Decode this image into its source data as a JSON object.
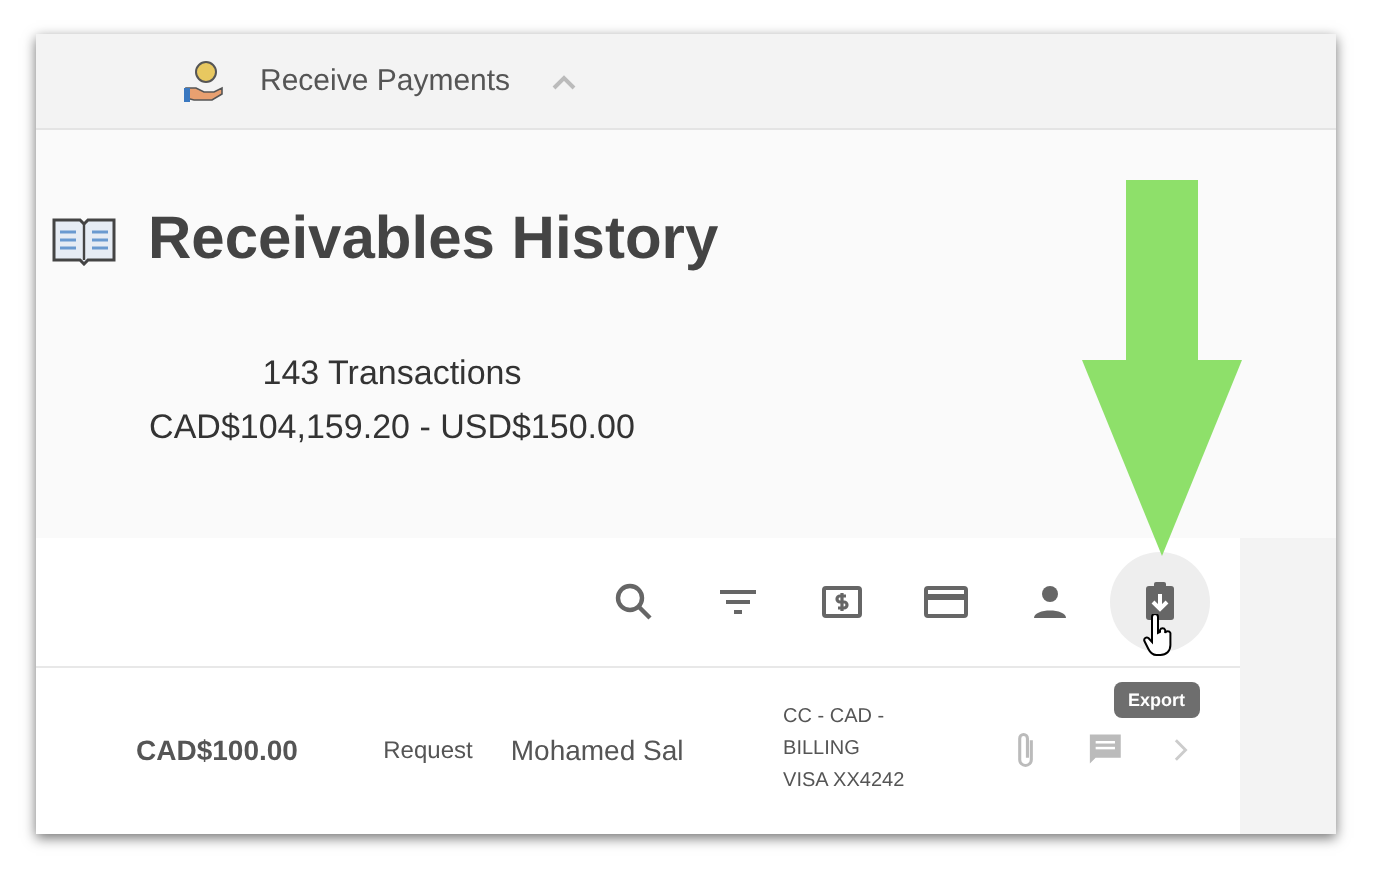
{
  "header": {
    "title": "Receive Payments",
    "expanded": true
  },
  "page": {
    "title": "Receivables History"
  },
  "summary": {
    "count": "143 Transactions",
    "totals": "CAD$104,159.20 - USD$150.00"
  },
  "toolbar": [
    {
      "kind": "search",
      "hovered": false
    },
    {
      "kind": "filter",
      "hovered": false
    },
    {
      "kind": "cash",
      "hovered": false
    },
    {
      "kind": "card",
      "hovered": false
    },
    {
      "kind": "person",
      "hovered": false
    },
    {
      "kind": "export",
      "hovered": true
    }
  ],
  "tooltip": "Export",
  "rows": [
    {
      "amount": "CAD$100.00",
      "type": "Request",
      "name": "Mohamed Sal",
      "details": [
        "CC - CAD -",
        "BILLING",
        "VISA XX4242"
      ]
    }
  ]
}
